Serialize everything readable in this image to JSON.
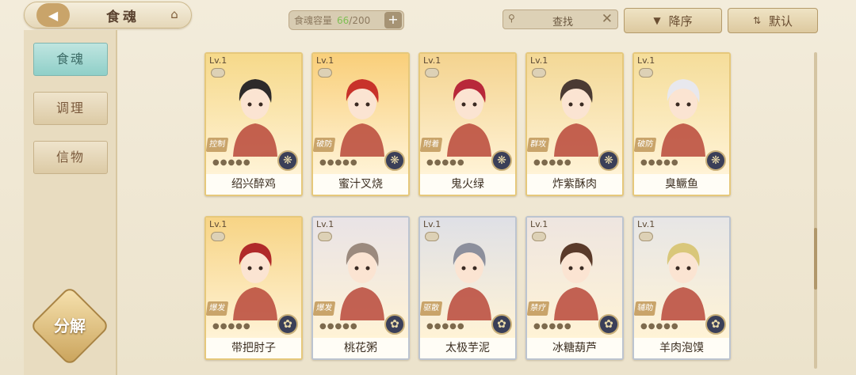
{
  "header": {
    "tab_title": "食魂",
    "capacity_label": "食魂容量",
    "capacity_current": "66",
    "capacity_total": "/200",
    "search_label": "查找",
    "sort_desc_label": "降序",
    "sort_default_label": "默认"
  },
  "sidebar": {
    "items": [
      {
        "label": "食魂"
      },
      {
        "label": "调理"
      },
      {
        "label": "信物"
      }
    ],
    "decompose_label": "分解"
  },
  "cards": [
    {
      "level": "Lv.1",
      "name": "绍兴醉鸡",
      "role": "控制",
      "frame": "gold",
      "art_color": "#f6d98a",
      "hair_color": "#2d2a2a",
      "emblem": "❋"
    },
    {
      "level": "Lv.1",
      "name": "蜜汁叉烧",
      "role": "破防",
      "frame": "gold",
      "art_color": "#f9cf7a",
      "hair_color": "#c8322a",
      "emblem": "❋"
    },
    {
      "level": "Lv.1",
      "name": "鬼火绿",
      "role": "附着",
      "frame": "gold",
      "art_color": "#f4d38f",
      "hair_color": "#b8283a",
      "emblem": "❋"
    },
    {
      "level": "Lv.1",
      "name": "炸紫酥肉",
      "role": "群攻",
      "frame": "gold",
      "art_color": "#f3d896",
      "hair_color": "#4a3a33",
      "emblem": "❋"
    },
    {
      "level": "Lv.1",
      "name": "臭鳜鱼",
      "role": "破防",
      "frame": "gold",
      "art_color": "#f5dd9a",
      "hair_color": "#e8e8ee",
      "emblem": "❋"
    },
    {
      "level": "Lv.1",
      "name": "带把肘子",
      "role": "爆发",
      "frame": "gold",
      "art_color": "#f7d485",
      "hair_color": "#b02a2a",
      "emblem": "✿"
    },
    {
      "level": "Lv.1",
      "name": "桃花粥",
      "role": "爆发",
      "frame": "silver",
      "art_color": "#e9e3e6",
      "hair_color": "#9b8a7e",
      "emblem": "✿"
    },
    {
      "level": "Lv.1",
      "name": "太极芋泥",
      "role": "驱散",
      "frame": "silver",
      "art_color": "#dfe0e6",
      "hair_color": "#8c8f9c",
      "emblem": "✿"
    },
    {
      "level": "Lv.1",
      "name": "冰糖葫芦",
      "role": "禁疗",
      "frame": "silver",
      "art_color": "#eee5e0",
      "hair_color": "#5a3a2a",
      "emblem": "✿"
    },
    {
      "level": "Lv.1",
      "name": "羊肉泡馍",
      "role": "辅助",
      "frame": "silver",
      "art_color": "#e7e6e6",
      "hair_color": "#d9c77a",
      "emblem": "✿"
    }
  ]
}
